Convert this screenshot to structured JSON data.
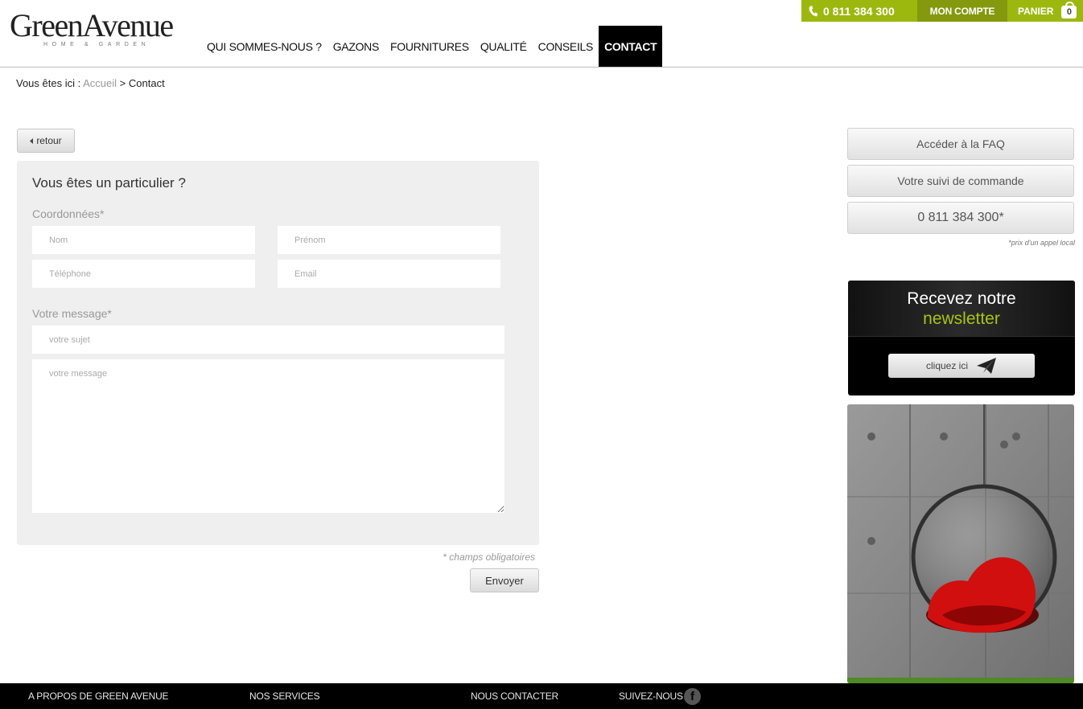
{
  "brand": {
    "name": "GreenAvenue",
    "tagline": "HOME & GARDEN"
  },
  "topbar": {
    "phone": "0 811 384 300",
    "account": "MON COMPTE",
    "cart_label": "PANIER",
    "cart_count": "0"
  },
  "nav": [
    {
      "label": "QUI SOMMES-NOUS ?"
    },
    {
      "label": "GAZONS"
    },
    {
      "label": "FOURNITURES"
    },
    {
      "label": "QUALITÉ"
    },
    {
      "label": "CONSEILS"
    },
    {
      "label": "CONTACT",
      "active": true
    }
  ],
  "breadcrumb": {
    "prefix": "Vous êtes ici :",
    "home": "Accueil",
    "separator": ">",
    "current": "Contact"
  },
  "form": {
    "back": "retour",
    "title": "Vous êtes un particulier ?",
    "contact_section": "Coordonnées*",
    "fields": {
      "nom": "Nom",
      "prenom": "Prénom",
      "telephone": "Téléphone",
      "email": "Email"
    },
    "message_section": "Votre message*",
    "subject_placeholder": "votre sujet",
    "message_placeholder": "votre message",
    "required_note": "* champs obligatoires",
    "submit": "Envoyer"
  },
  "sidebar": {
    "faq": "Accéder à la FAQ",
    "order_tracking": "Votre suivi de commande",
    "phone": "0 811 384 300*",
    "phone_note": "*prix d'un appel local",
    "newsletter_line1": "Recevez notre",
    "newsletter_line2": "newsletter",
    "newsletter_button": "cliquez ici"
  },
  "footer": {
    "about": "A PROPOS DE GREEN AVENUE",
    "services": "NOS SERVICES",
    "contact": "NOUS CONTACTER",
    "follow": "SUIVEZ-NOUS"
  },
  "colors": {
    "accent": "#9cb80f",
    "accent_dark": "#84990d",
    "newsletter_green": "#a7c512",
    "nav_active_bg": "#000000",
    "footer_bg": "#000000"
  },
  "icons": {
    "phone": "phone-icon",
    "cart": "cart-icon",
    "back": "chevron-left-icon",
    "newsletter": "paper-plane-icon",
    "social": "facebook-icon"
  }
}
